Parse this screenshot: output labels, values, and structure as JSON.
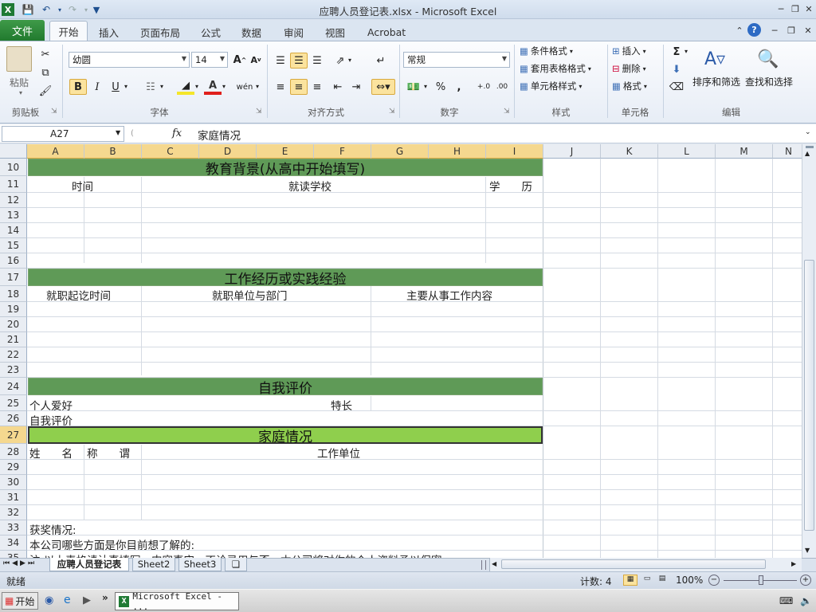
{
  "window": {
    "title": "应聘人员登记表.xlsx - Microsoft Excel"
  },
  "menu": {
    "file": "文件",
    "tabs": [
      "开始",
      "插入",
      "页面布局",
      "公式",
      "数据",
      "审阅",
      "视图",
      "Acrobat"
    ]
  },
  "ribbon": {
    "clipboard": {
      "paste": "粘贴",
      "group": "剪贴板"
    },
    "font": {
      "name": "幼圆",
      "size": "14",
      "bold": "B",
      "italic": "I",
      "underline": "U",
      "phonetic": "wén",
      "group": "字体"
    },
    "alignment": {
      "group": "对齐方式"
    },
    "number": {
      "format": "常规",
      "percent": "%",
      "comma": ",",
      "group": "数字"
    },
    "styles": {
      "conditional": "条件格式",
      "table": "套用表格格式",
      "cell": "单元格样式",
      "group": "样式"
    },
    "cells": {
      "insert": "插入",
      "delete": "删除",
      "format": "格式",
      "group": "单元格"
    },
    "editing": {
      "sum": "Σ",
      "sort": "排序和筛选",
      "find": "查找和选择",
      "group": "编辑"
    }
  },
  "formula_bar": {
    "name_box": "A27",
    "fx": "fx",
    "content": "家庭情况"
  },
  "sheet": {
    "columns": [
      "A",
      "B",
      "C",
      "D",
      "E",
      "F",
      "G",
      "H",
      "I",
      "J",
      "K",
      "L",
      "M",
      "N"
    ],
    "rows": [
      "10",
      "11",
      "12",
      "13",
      "14",
      "15",
      "16",
      "17",
      "18",
      "19",
      "20",
      "21",
      "22",
      "23",
      "24",
      "25",
      "26",
      "27",
      "28",
      "29",
      "30",
      "31",
      "32",
      "33",
      "34",
      "35"
    ],
    "bands": {
      "education": "教育背景(从高中开始填写)",
      "work": "工作经历或实践经验",
      "self": "自我评价",
      "family": "家庭情况"
    },
    "cells": {
      "time": "时间",
      "school": "就读学校",
      "degree": "学　　历",
      "work_period": "就职起讫时间",
      "work_unit": "就职单位与部门",
      "work_content": "主要从事工作内容",
      "hobby": "个人爱好",
      "specialty": "特长",
      "self_eval": "自我评价",
      "name": "姓　　名",
      "title": "称　　谓",
      "family_unit": "工作单位",
      "awards": "获奖情况:",
      "questions": "本公司哪些方面是你目前想了解的:",
      "note": "注:以上表格请认真填写，内容真实，不论录用与否，本公司将对你的个人资料予以保密"
    }
  },
  "sheet_tabs": [
    "应聘人员登记表",
    "Sheet2",
    "Sheet3"
  ],
  "status": {
    "ready": "就绪",
    "count": "计数: 4",
    "zoom": "100%"
  },
  "taskbar": {
    "start": "开始",
    "excel_task": "Microsoft Excel - ..."
  }
}
